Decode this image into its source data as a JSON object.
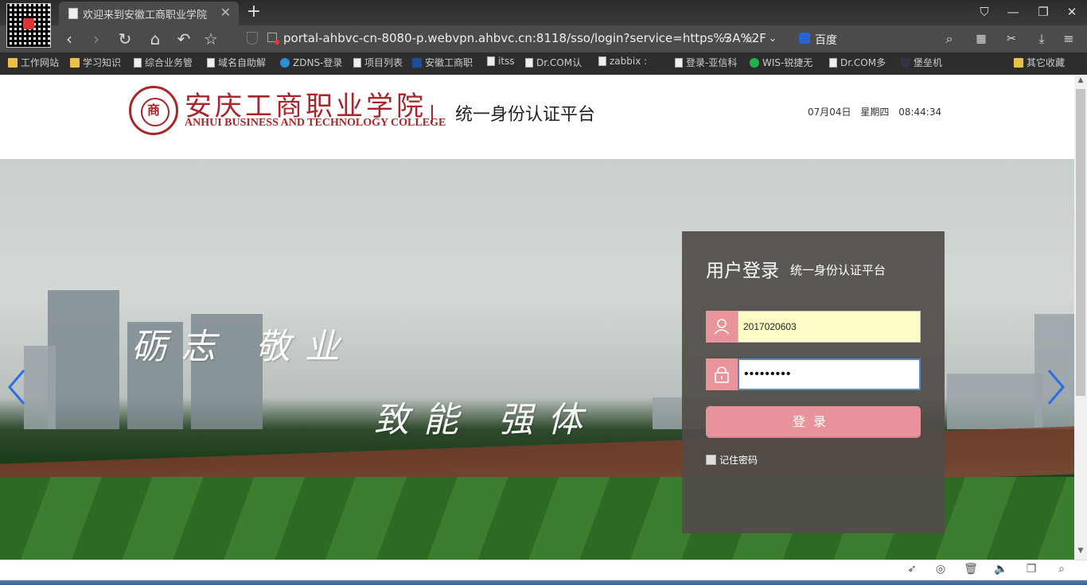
{
  "browser": {
    "tab_title": "欢迎来到安徽工商职业学院",
    "new_tab": "+",
    "url": "portal-ahbvc-cn-8080-p.webvpn.ahbvc.cn:8118/sso/login?service=https%3A%2F",
    "search_engine": "百度",
    "bookmarks": [
      {
        "label": "工作网站",
        "icon": "folder"
      },
      {
        "label": "学习知识",
        "icon": "folder"
      },
      {
        "label": "综合业务管",
        "icon": "page"
      },
      {
        "label": "域名自助解",
        "icon": "page"
      },
      {
        "label": "ZDNS-登录",
        "icon": "z"
      },
      {
        "label": "项目列表",
        "icon": "page"
      },
      {
        "label": "安徽工商职",
        "icon": "bl"
      },
      {
        "label": "itss",
        "icon": "page"
      },
      {
        "label": "Dr.COM认",
        "icon": "page"
      },
      {
        "label": "zabbix :",
        "icon": "page"
      },
      {
        "label": "登录-亚信科",
        "icon": "page"
      },
      {
        "label": "WIS-锐捷无",
        "icon": "green"
      },
      {
        "label": "Dr.COM多",
        "icon": "page"
      },
      {
        "label": "堡垒机",
        "icon": "shield"
      },
      {
        "label": "其它收藏",
        "icon": "folder"
      }
    ]
  },
  "header": {
    "school_name_cn": "安庆工商职业学院",
    "school_name_en": "ANHUI BUSINESS AND TECHNOLOGY COLLEGE",
    "seal_char": "商",
    "platform_title": "统一身份认证平台",
    "date": "07月04日",
    "weekday": "星期四",
    "time": "08:44:34"
  },
  "banner": {
    "slogan_1": "砺志 敬业",
    "slogan_2": "致能 强体"
  },
  "login": {
    "title": "用户登录",
    "subtitle": "统一身份认证平台",
    "username": "2017020603",
    "password_mask": "•••••••••",
    "button": "登录",
    "remember": "记住密码"
  },
  "colors": {
    "brand": "#a8252b",
    "login_accent": "#e8939c",
    "panel_bg": "#504c48"
  }
}
